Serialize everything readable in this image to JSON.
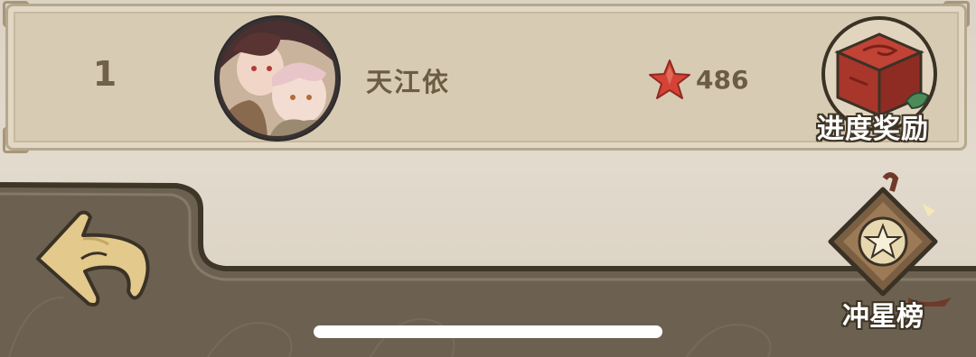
{
  "rank_row": {
    "rank": "1",
    "player_name": "天江依",
    "star_count": "486"
  },
  "buttons": {
    "progress_reward_label": "进度奖励",
    "star_ranking_label": "冲星榜"
  },
  "icons": {
    "star": "star-icon",
    "chest": "treasure-chest-icon",
    "back": "back-arrow-icon",
    "ranking_badge": "star-badge-icon"
  },
  "colors": {
    "card": "#d8cbb3",
    "text": "#6b5d44",
    "star": "#d64336",
    "chest": "#b5342a",
    "lower_panel": "#6c6151"
  }
}
